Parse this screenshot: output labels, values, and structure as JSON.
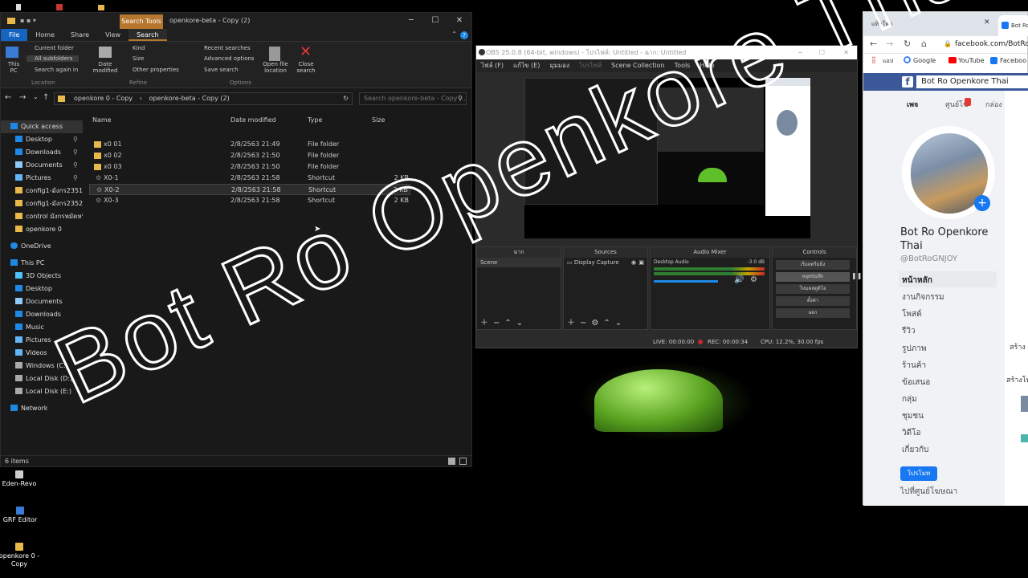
{
  "desktop_icons": [
    {
      "label": "Eden-Revo",
      "icon": "app-icon"
    },
    {
      "label": "GRF Editor",
      "icon": "app-icon"
    },
    {
      "label": "openkore 0 - Copy",
      "icon": "folder-icon"
    }
  ],
  "explorer": {
    "title": "openkore-beta - Copy (2)",
    "context_tab": "Search Tools",
    "tabs": [
      "File",
      "Home",
      "Share",
      "View",
      "Search"
    ],
    "ribbon": {
      "this_pc": "This PC",
      "current_folder": "Current folder",
      "all_subfolders": "All subfolders",
      "search_again_in": "Search again in",
      "location": "Location",
      "date_modified": "Date modified",
      "kind": "Kind",
      "size": "Size",
      "other_properties": "Other properties",
      "refine": "Refine",
      "recent_searches": "Recent searches",
      "advanced_options": "Advanced options",
      "save_search": "Save search",
      "open_file_location": "Open file location",
      "close_search": "Close search",
      "options": "Options"
    },
    "address": {
      "crumb1": "openkore 0 - Copy",
      "crumb2": "openkore-beta - Copy (2)",
      "search_placeholder": "Search openkore-beta - Copy ..."
    },
    "nav": {
      "quick_access": "Quick access",
      "items": [
        "Desktop",
        "Downloads",
        "Documents",
        "Pictures",
        "config1-มังกร2351",
        "config1-มังกร2352",
        "control มังกรหมัดหนึ่ง23",
        "openkore 0"
      ],
      "onedrive": "OneDrive",
      "this_pc": "This PC",
      "pc_items": [
        "3D Objects",
        "Desktop",
        "Documents",
        "Downloads",
        "Music",
        "Pictures",
        "Videos",
        "Windows (C:)",
        "Local Disk (D:)",
        "Local Disk (E:)"
      ],
      "network": "Network"
    },
    "columns": [
      "Name",
      "Date modified",
      "Type",
      "Size"
    ],
    "files": [
      {
        "name": "x0 01",
        "date": "2/8/2563 21:49",
        "type": "File folder",
        "size": ""
      },
      {
        "name": "x0 02",
        "date": "2/8/2563 21:50",
        "type": "File folder",
        "size": ""
      },
      {
        "name": "x0 03",
        "date": "2/8/2563 21:50",
        "type": "File folder",
        "size": ""
      },
      {
        "name": "X0-1",
        "date": "2/8/2563 21:58",
        "type": "Shortcut",
        "size": "2 KB"
      },
      {
        "name": "X0-2",
        "date": "2/8/2563 21:58",
        "type": "Shortcut",
        "size": "2 KB"
      },
      {
        "name": "X0-3",
        "date": "2/8/2563 21:58",
        "type": "Shortcut",
        "size": "2 KB"
      }
    ],
    "status": "6 items"
  },
  "obs": {
    "title": "OBS 25.0.8 (64-bit, windows) - โปรไฟล์: Untitled - ฉาก: Untitled",
    "menu": [
      "ไฟล์ (F)",
      "แก้ไข (E)",
      "มุมมอง",
      "โปรไฟล์",
      "Scene Collection",
      "Tools",
      "Help"
    ],
    "docks": {
      "scenes": "ฉาก",
      "sources": "Sources",
      "mixer": "Audio Mixer",
      "controls": "Controls"
    },
    "scene_item": "Scene",
    "source_item": "Display Capture",
    "mixer_item": "Desktop Audio",
    "mixer_db": "-3.0 dB",
    "controls": [
      "เริ่มสตรีมมิ่ง",
      "หยุดบันทึก",
      "โหมดสตูดิโอ",
      "ตั้งค่า",
      "ออก"
    ],
    "status": {
      "live": "LIVE: 00:00:00",
      "rec": "REC: 00:00:34",
      "cpu": "CPU: 12.2%, 30.00 fps"
    }
  },
  "browser": {
    "tab1": "แท็บใหม่",
    "tab2": "Bot Ro",
    "url": "facebook.com/BotRo",
    "bookmarks": [
      "แอป",
      "Google",
      "YouTube",
      "Faceboo"
    ],
    "fb_search": "Bot Ro Openkore Thai",
    "fb_tabs": [
      "เพจ",
      "ศูนย์โฆ",
      "กล่อง"
    ],
    "page_name": "Bot Ro Openkore Thai",
    "handle": "@BotRoGNJOY",
    "menu": [
      "หน้าหลัก",
      "งานกิจกรรม",
      "โพสต์",
      "รีวิว",
      "รูปภาพ",
      "ร้านค้า",
      "ข้อเสนอ",
      "กลุ่ม",
      "ชุมชน",
      "วิดีโอ",
      "เกี่ยวกับ"
    ],
    "promote": "โปรโมท",
    "ads_center": "ไปที่ศูนย์โฆษณา",
    "side_create": "สร้าง",
    "side_create2": "สร้างโพ"
  },
  "watermark": "Bot Ro Openkore Thai",
  "colors": {
    "accent": "#b7762d",
    "folder": "#e8b84a",
    "fb_blue": "#3b5998",
    "grass": "#7cd93a"
  }
}
